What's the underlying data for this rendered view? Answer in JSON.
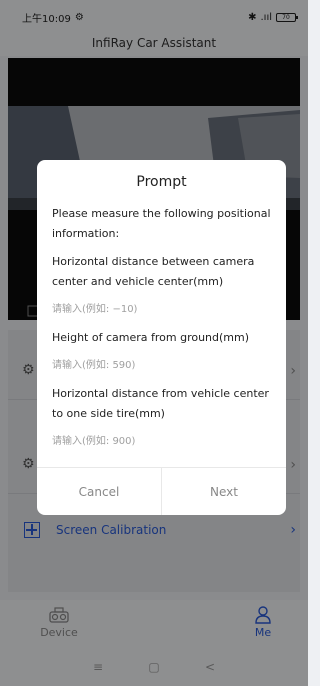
{
  "status_bar": {
    "time": "上午10:09",
    "battery": "70"
  },
  "app": {
    "title": "InfiRay Car Assistant"
  },
  "menu": {
    "calibration_label": "Screen Calibration"
  },
  "tabs": [
    {
      "label": "Device",
      "icon": "car-camera-icon",
      "active": false
    },
    {
      "label": "Me",
      "icon": "person-icon",
      "active": true
    }
  ],
  "nav": {
    "menu_glyph": "≡",
    "home_glyph": "▢",
    "back_glyph": "<"
  },
  "dialog": {
    "title": "Prompt",
    "message": "Please measure the following positional information:",
    "fields": [
      {
        "label": "Horizontal distance between camera center and vehicle center(mm)",
        "placeholder": "请输入(例如: −10)"
      },
      {
        "label": "Height of camera from ground(mm)",
        "placeholder": "请输入(例如: 590)"
      },
      {
        "label": "Horizontal distance from vehicle center to one side tire(mm)",
        "placeholder": "请输入(例如: 900)"
      }
    ],
    "cancel_label": "Cancel",
    "next_label": "Next"
  },
  "colors": {
    "accent": "#2a5bd7",
    "overlay": "rgba(0,0,0,0.42)"
  }
}
